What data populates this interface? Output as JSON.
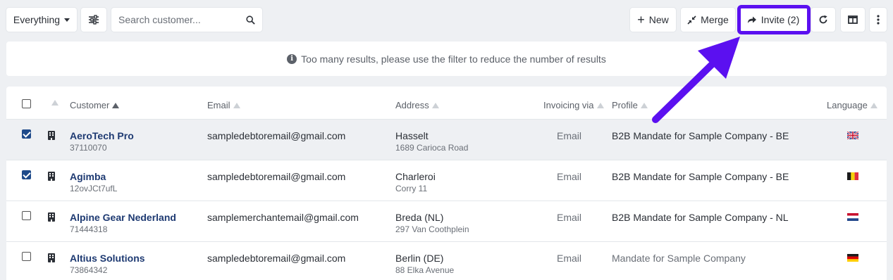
{
  "toolbar": {
    "filter_label": "Everything",
    "search_placeholder": "Search customer...",
    "new_label": "New",
    "merge_label": "Merge",
    "invite_label": "Invite (2)"
  },
  "info": {
    "message": "Too many results, please use the filter to reduce the number of results"
  },
  "table": {
    "headers": {
      "customer": "Customer",
      "email": "Email",
      "address": "Address",
      "invoicing": "Invoicing via",
      "profile": "Profile",
      "language": "Language"
    },
    "rows": [
      {
        "name": "AeroTech Pro",
        "id": "37110070",
        "email": "sampledebtoremail@gmail.com",
        "city": "Hasselt",
        "street": "1689 Carioca Road",
        "invoicing": "Email",
        "profile": "B2B Mandate for Sample Company - BE",
        "language": "uk-flag",
        "checked": true
      },
      {
        "name": "Agimba",
        "id": "12ovJCt7ufL",
        "email": "sampledebtoremail@gmail.com",
        "city": "Charleroi",
        "street": "Corry 11",
        "invoicing": "Email",
        "profile": "B2B Mandate for Sample Company - BE",
        "language": "be-flag",
        "checked": true
      },
      {
        "name": "Alpine Gear Nederland",
        "id": "71444318",
        "email": "samplemerchantemail@gmail.com",
        "city": "Breda (NL)",
        "street": "297 Van Coothplein",
        "invoicing": "Email",
        "profile": "B2B Mandate for Sample Company - NL",
        "language": "nl-flag",
        "checked": false
      },
      {
        "name": "Altius Solutions",
        "id": "73864342",
        "email": "sampledebtoremail@gmail.com",
        "city": "Berlin (DE)",
        "street": "88 Elka Avenue",
        "invoicing": "Email",
        "profile": "Mandate for Sample Company",
        "language": "de-flag",
        "checked": false
      }
    ]
  },
  "colors": {
    "accent": "#5b10f0",
    "link": "#1e3a72",
    "checkbox": "#1e4a8a"
  }
}
